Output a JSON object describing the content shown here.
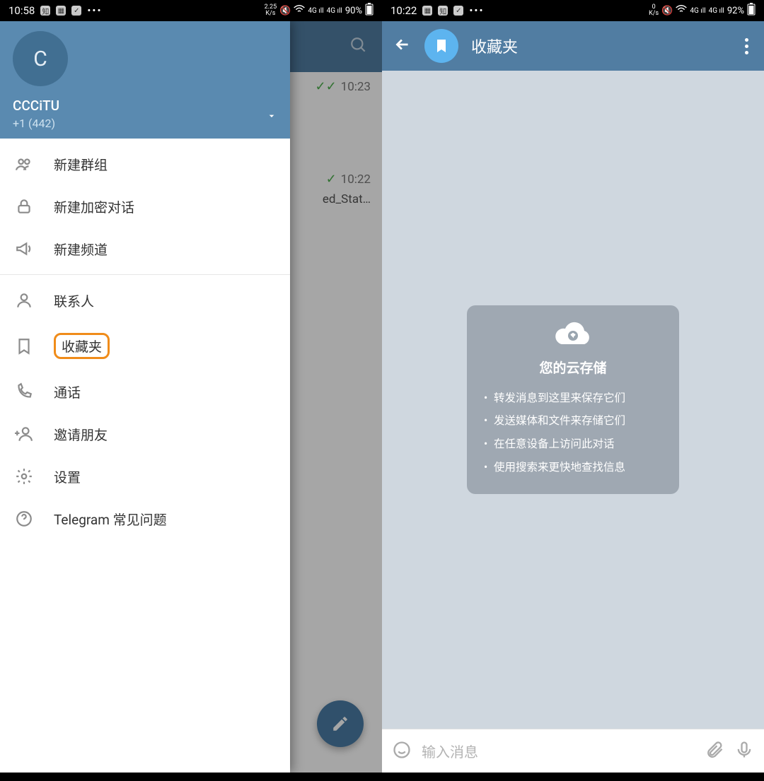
{
  "left": {
    "status": {
      "time": "10:58",
      "speed_top": "2.25",
      "speed_unit": "K/s",
      "battery": "90%"
    },
    "drawer": {
      "avatar_initial": "C",
      "name": "CCCiTU",
      "phone": "+1 (442)",
      "items": [
        {
          "key": "new-group",
          "label": "新建群组"
        },
        {
          "key": "new-secret",
          "label": "新建加密对话"
        },
        {
          "key": "new-channel",
          "label": "新建频道"
        }
      ],
      "items2": [
        {
          "key": "contacts",
          "label": "联系人"
        },
        {
          "key": "saved",
          "label": "收藏夹",
          "highlight": true
        },
        {
          "key": "calls",
          "label": "通话"
        },
        {
          "key": "invite",
          "label": "邀请朋友"
        },
        {
          "key": "settings",
          "label": "设置"
        },
        {
          "key": "faq",
          "label": "Telegram 常见问题"
        }
      ]
    },
    "peek": {
      "row1_time": "10:23",
      "row2_time": "10:22",
      "row2_text": "ed_Stat…"
    }
  },
  "right": {
    "status": {
      "time": "10:22",
      "speed_top": "0",
      "speed_unit": "K/s",
      "battery": "92%"
    },
    "header_title": "收藏夹",
    "cloud": {
      "title": "您的云存储",
      "bullets": [
        "转发消息到这里来保存它们",
        "发送媒体和文件来存储它们",
        "在任意设备上访问此对话",
        "使用搜索来更快地查找信息"
      ]
    },
    "input_placeholder": "输入消息"
  }
}
